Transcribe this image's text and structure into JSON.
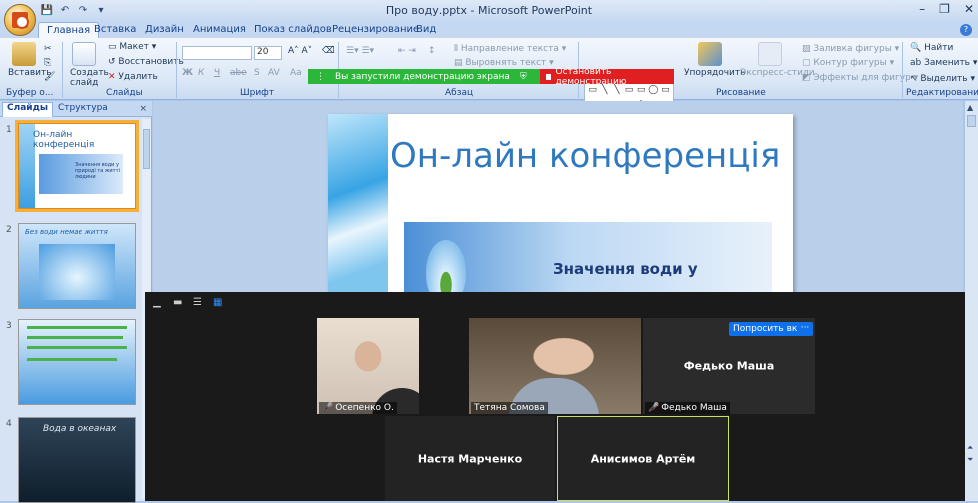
{
  "window": {
    "title": "Про воду.pptx - Microsoft PowerPoint",
    "controls": [
      "–",
      "❐",
      "✕"
    ]
  },
  "qat": [
    "💾",
    "↶",
    "↷",
    "▾"
  ],
  "tabs": [
    "Главная",
    "Вставка",
    "Дизайн",
    "Анимация",
    "Показ слайдов",
    "Рецензирование",
    "Вид"
  ],
  "ribbon": {
    "clipboard": {
      "paste": "Вставить",
      "label": "Буфер о..."
    },
    "slides": {
      "create": "Создать слайд",
      "layout": "Макет",
      "reset": "Восстановить",
      "delete": "Удалить",
      "label": "Слайды"
    },
    "font": {
      "size": "20",
      "bold": "Ж",
      "italic": "К",
      "underline": "Ч",
      "strike": "abe",
      "shadow": "S",
      "spacing": "AV",
      "case": "Aa",
      "label": "Шрифт"
    },
    "paragraph": {
      "direction": "Направление текста",
      "align": "Выровнять текст",
      "label": "Абзац"
    },
    "drawing": {
      "arrange": "Упорядочить",
      "express": "Экспресс-стили",
      "fill": "Заливка фигуры",
      "outline": "Контур фигуры",
      "effects": "Эффекты для фигур",
      "label": "Рисование"
    },
    "editing": {
      "find": "Найти",
      "replace": "Заменить",
      "select": "Выделить",
      "label": "Редактирование"
    }
  },
  "share": {
    "status": "Вы запустили демонстрацию экрана",
    "stop": "Остановить демонстрацию"
  },
  "sidebar": {
    "tabs": [
      "Слайды",
      "Структура"
    ],
    "close": "×",
    "slides": [
      {
        "num": "1",
        "title": "Он-лайн конференція",
        "subtitle": "Значення води у природі та житті людини"
      },
      {
        "num": "2",
        "title": "Без води немає життя"
      },
      {
        "num": "3",
        "title": ""
      },
      {
        "num": "4",
        "title": "Вода в океанах"
      }
    ]
  },
  "slide": {
    "title": "Он-лайн конференція",
    "text": "Значення води у"
  },
  "zoom": {
    "ask_button": "Попросить вкл",
    "more_button": "···",
    "participants": [
      {
        "name": "Осепенко О.",
        "muted": true
      },
      {
        "name": "Тетяна Сомова",
        "muted": false
      },
      {
        "name": "Федько Маша",
        "muted": true,
        "label": "Федько Маша"
      },
      {
        "name": "Настя Марченко"
      },
      {
        "name": "Анисимов Артём"
      }
    ]
  }
}
